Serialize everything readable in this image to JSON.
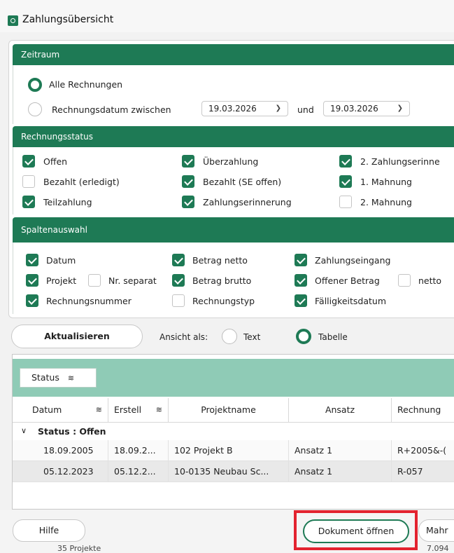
{
  "window": {
    "title": "Zahlungsübersicht"
  },
  "zeitraum": {
    "header": "Zeitraum",
    "all_label": "Alle Rechnungen",
    "between_label": "Rechnungsdatum zwischen",
    "date_from": "19.03.2026",
    "and_label": "und",
    "date_to": "19.03.2026"
  },
  "status": {
    "header": "Rechnungsstatus",
    "items": [
      {
        "label": "Offen",
        "checked": true
      },
      {
        "label": "Überzahlung",
        "checked": true
      },
      {
        "label": "2. Zahlungserinne",
        "checked": true
      },
      {
        "label": "Bezahlt (erledigt)",
        "checked": false
      },
      {
        "label": "Bezahlt (SE offen)",
        "checked": true
      },
      {
        "label": "1. Mahnung",
        "checked": true
      },
      {
        "label": "Teilzahlung",
        "checked": true
      },
      {
        "label": "Zahlungserinnerung",
        "checked": true
      },
      {
        "label": "2. Mahnung",
        "checked": false
      }
    ]
  },
  "spalten": {
    "header": "Spaltenauswahl",
    "items": [
      {
        "label": "Datum",
        "checked": true
      },
      {
        "label": "Betrag netto",
        "checked": true
      },
      {
        "label": "Zahlungseingang",
        "checked": true
      },
      {
        "label": "Projekt",
        "checked": true
      },
      {
        "label": "Nr. separat",
        "checked": false
      },
      {
        "label": "Betrag brutto",
        "checked": true
      },
      {
        "label": "Offener Betrag",
        "checked": true
      },
      {
        "label": "netto",
        "checked": false
      },
      {
        "label": "Rechnungsnummer",
        "checked": true
      },
      {
        "label": "Rechnungstyp",
        "checked": false
      },
      {
        "label": "Fälligkeitsdatum",
        "checked": true
      }
    ]
  },
  "toolbar": {
    "refresh": "Aktualisieren",
    "view_as": "Ansicht als:",
    "text": "Text",
    "table": "Tabelle"
  },
  "grid": {
    "group_chip": "Status",
    "columns": [
      "Datum",
      "Erstell",
      "Projektname",
      "Ansatz",
      "Rechnung"
    ],
    "group_label": "Status : Offen",
    "rows": [
      [
        "18.09.2005",
        "18.09.2...",
        "102 Projekt B",
        "Ansatz 1",
        "R+2005&-("
      ],
      [
        "05.12.2023",
        "05.12.2...",
        "10-0135 Neubau Sc...",
        "Ansatz 1",
        "R-057"
      ]
    ]
  },
  "footer": {
    "help": "Hilfe",
    "open_doc": "Dokument öffnen",
    "dunning": "Mahr",
    "below_left": "35 Projekte",
    "below_right": "7.094"
  },
  "colors": {
    "accent": "#1e7a55",
    "group_band": "#8fcbb6",
    "highlight": "#e3232f"
  }
}
